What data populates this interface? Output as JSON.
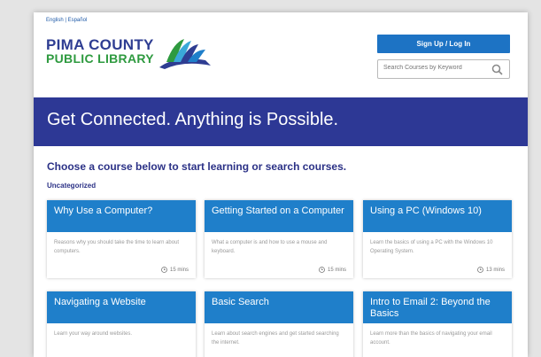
{
  "header": {
    "language_links": "English | Español",
    "logo": {
      "line1": "PIMA COUNTY",
      "line2": "PUBLIC LIBRARY"
    },
    "signup_label": "Sign Up / Log In",
    "search_placeholder": "Search Courses by Keyword"
  },
  "banner": {
    "text": "Get Connected. Anything is Possible."
  },
  "main": {
    "heading": "Choose a course below to start learning or search courses.",
    "category": "Uncategorized"
  },
  "courses": [
    {
      "title": "Why Use a Computer?",
      "desc": "Reasons why you should take the time to learn about computers.",
      "time": "15 mins"
    },
    {
      "title": "Getting Started on a Computer",
      "desc": "What a computer is and how to use a mouse and keyboard.",
      "time": "15 mins"
    },
    {
      "title": "Using a PC (Windows 10)",
      "desc": "Learn the basics of using a PC with the Windows 10 Operating System.",
      "time": "13 mins"
    },
    {
      "title": "Navigating a Website",
      "desc": "Learn your way around websites.",
      "time": ""
    },
    {
      "title": "Basic Search",
      "desc": "Learn about search engines and get started searching the internet.",
      "time": ""
    },
    {
      "title": "Intro to Email 2: Beyond the Basics",
      "desc": "Learn more than the basics of navigating your email account.",
      "time": ""
    }
  ],
  "colors": {
    "brand_navy": "#2d3895",
    "card_blue": "#1f7fca",
    "button_blue": "#1d73c4",
    "brand_green": "#2e9a3f"
  }
}
